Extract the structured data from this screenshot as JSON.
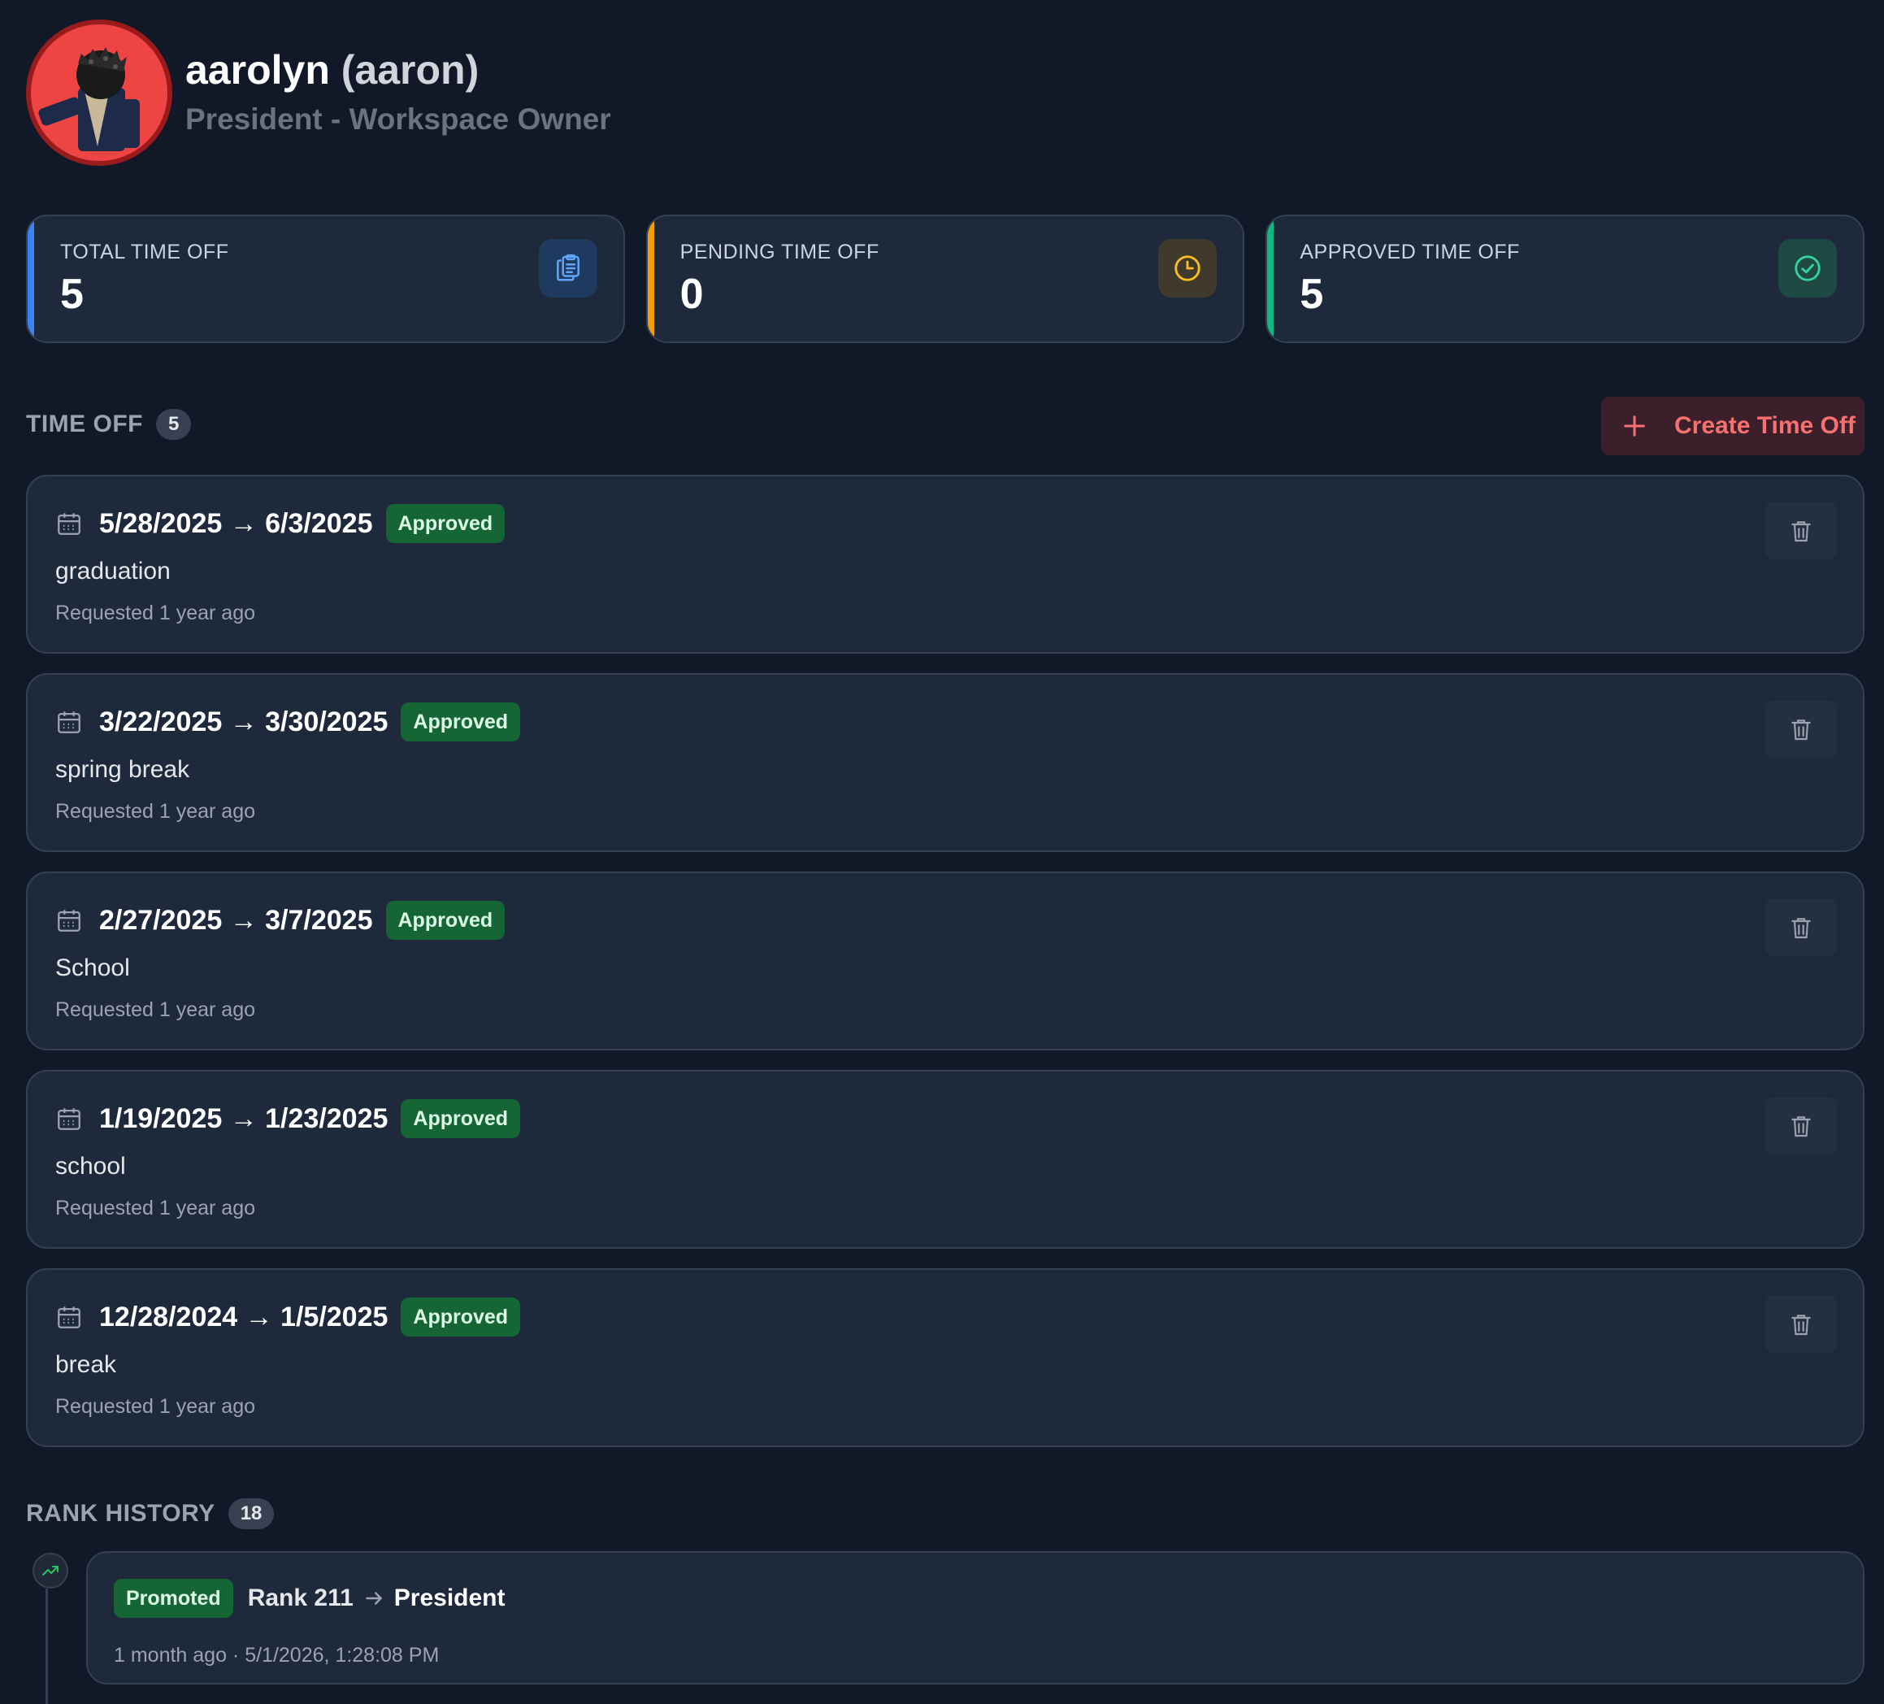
{
  "profile": {
    "display_name": "aarolyn",
    "username": "(aaron)",
    "role": "President - Workspace Owner",
    "avatar_icon": "roblox-avatar"
  },
  "stats": [
    {
      "label": "TOTAL TIME OFF",
      "value": "5",
      "icon": "clipboard-icon",
      "accent": "#3b82f6",
      "icon_bg": "#1e3a5f",
      "icon_color": "#60a5fa"
    },
    {
      "label": "PENDING TIME OFF",
      "value": "0",
      "icon": "clock-icon",
      "accent": "#f59e0b",
      "icon_bg": "#3f3a2b",
      "icon_color": "#fbbf24"
    },
    {
      "label": "APPROVED TIME OFF",
      "value": "5",
      "icon": "check-circle-icon",
      "accent": "#10b981",
      "icon_bg": "#1f4a44",
      "icon_color": "#34d399"
    }
  ],
  "timeoff": {
    "title": "TIME OFF",
    "count": "5",
    "create_label": "Create Time Off",
    "items": [
      {
        "dates": "5/28/2025 → 6/3/2025",
        "status": "Approved",
        "reason": "graduation",
        "requested": "Requested 1 year ago"
      },
      {
        "dates": "3/22/2025 → 3/30/2025",
        "status": "Approved",
        "reason": "spring break",
        "requested": "Requested 1 year ago"
      },
      {
        "dates": "2/27/2025 → 3/7/2025",
        "status": "Approved",
        "reason": "School",
        "requested": "Requested 1 year ago"
      },
      {
        "dates": "1/19/2025 → 1/23/2025",
        "status": "Approved",
        "reason": "school",
        "requested": "Requested 1 year ago"
      },
      {
        "dates": "12/28/2024 → 1/5/2025",
        "status": "Approved",
        "reason": "break",
        "requested": "Requested 1 year ago"
      }
    ]
  },
  "rank_history": {
    "title": "RANK HISTORY",
    "count": "18",
    "entries": [
      {
        "type": "Promoted",
        "from": "Rank 211",
        "to": "President",
        "meta": "1 month ago · 5/1/2026, 1:28:08 PM"
      }
    ]
  },
  "colors": {
    "background": "#111827",
    "card": "#1e293b",
    "approved_badge": "#166534",
    "create_button_text": "#f87171"
  }
}
